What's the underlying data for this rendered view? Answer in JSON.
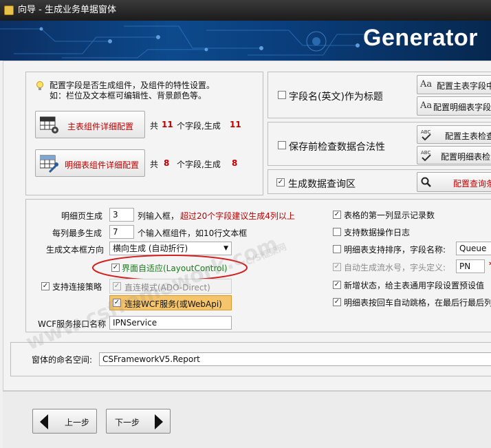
{
  "window": {
    "title": "向导 - 生成业务单据窗体"
  },
  "banner": {
    "text": "Generator"
  },
  "hint": {
    "line1": "配置字段是否生成组件，及组件的特性设置。",
    "line2": "如：栏位及文本框可编辑性、背景颜色等。"
  },
  "master_config": {
    "button_label": "主表组件详细配置",
    "total_prefix": "共",
    "total_count": "11",
    "middle_text": "个字段,生成",
    "generated_count": "11"
  },
  "detail_config": {
    "button_label": "明细表组件详细配置",
    "total_prefix": "共",
    "total_count": "8",
    "middle_text": "个字段,生成",
    "generated_count": "8"
  },
  "right_options": {
    "field_name_title": {
      "label": "字段名(英文)作为标题",
      "checked": false
    },
    "config_master_field": "配置主表字段中",
    "config_detail_field": "配置明细表字段",
    "validate_before_save": {
      "label": "保存前检查数据合法性",
      "checked": false
    },
    "config_master_check": "配置主表检查",
    "config_detail_check": "配置明细表检",
    "generate_query_area": {
      "label": "生成数据查询区",
      "checked": true
    },
    "config_query": "配置查询条"
  },
  "layout_options": {
    "detail_page_label": "明细页生成",
    "detail_page_value": "3",
    "detail_page_suffix": "列输入框，",
    "detail_page_warning": "超过20个字段建议生成4列以上",
    "max_per_column_label": "每列最多生成",
    "max_per_column_value": "7",
    "max_per_column_suffix": "个输入框组件，如10行文本框",
    "textbox_direction_label": "生成文本框方向",
    "textbox_direction_value": "横向生成 (自动折行)",
    "adaptive_ui": {
      "label": "界面自适应(LayoutControl)",
      "checked": true
    },
    "connection_strategy": {
      "label": "支持连接策略",
      "checked": true
    },
    "direct_mode": {
      "label": "直连模式(ADO-Direct)",
      "checked": true
    },
    "wcf_mode": {
      "label": "连接WCF服务(或WebApi)",
      "checked": true
    },
    "wcf_interface_label": "WCF服务接口名称",
    "wcf_interface_value": "IPNService"
  },
  "grid_options": {
    "show_record_no": {
      "label": "表格的第一列显示记录数",
      "checked": true
    },
    "operation_log": {
      "label": "支持数据操作日志",
      "checked": false
    },
    "detail_sort": {
      "label": "明细表支持排序，字段名称:",
      "checked": false,
      "value": "Queue"
    },
    "auto_serial": {
      "label": "自动生成流水号，字头定义:",
      "checked": true,
      "value": "PN",
      "required_mark": "*"
    },
    "new_state_defaults": {
      "label": "新增状态，给主表通用字段设置预设值",
      "checked": true
    },
    "enter_jump": {
      "label": "明细表按回车自动跳格，在最后行最后列自",
      "checked": true
    }
  },
  "namespace": {
    "label": "窗体的命名空间:",
    "value": "CSFrameworkV5.Report"
  },
  "navigation": {
    "prev_label": "上一步",
    "next_label": "下一步"
  },
  "watermarks": {
    "main": "www.csframework.com",
    "sub": "C/S框架网"
  },
  "colors": {
    "warning": "#c00000",
    "highlight_ellipse": "#d32020",
    "banner": "#0b3d7a"
  }
}
